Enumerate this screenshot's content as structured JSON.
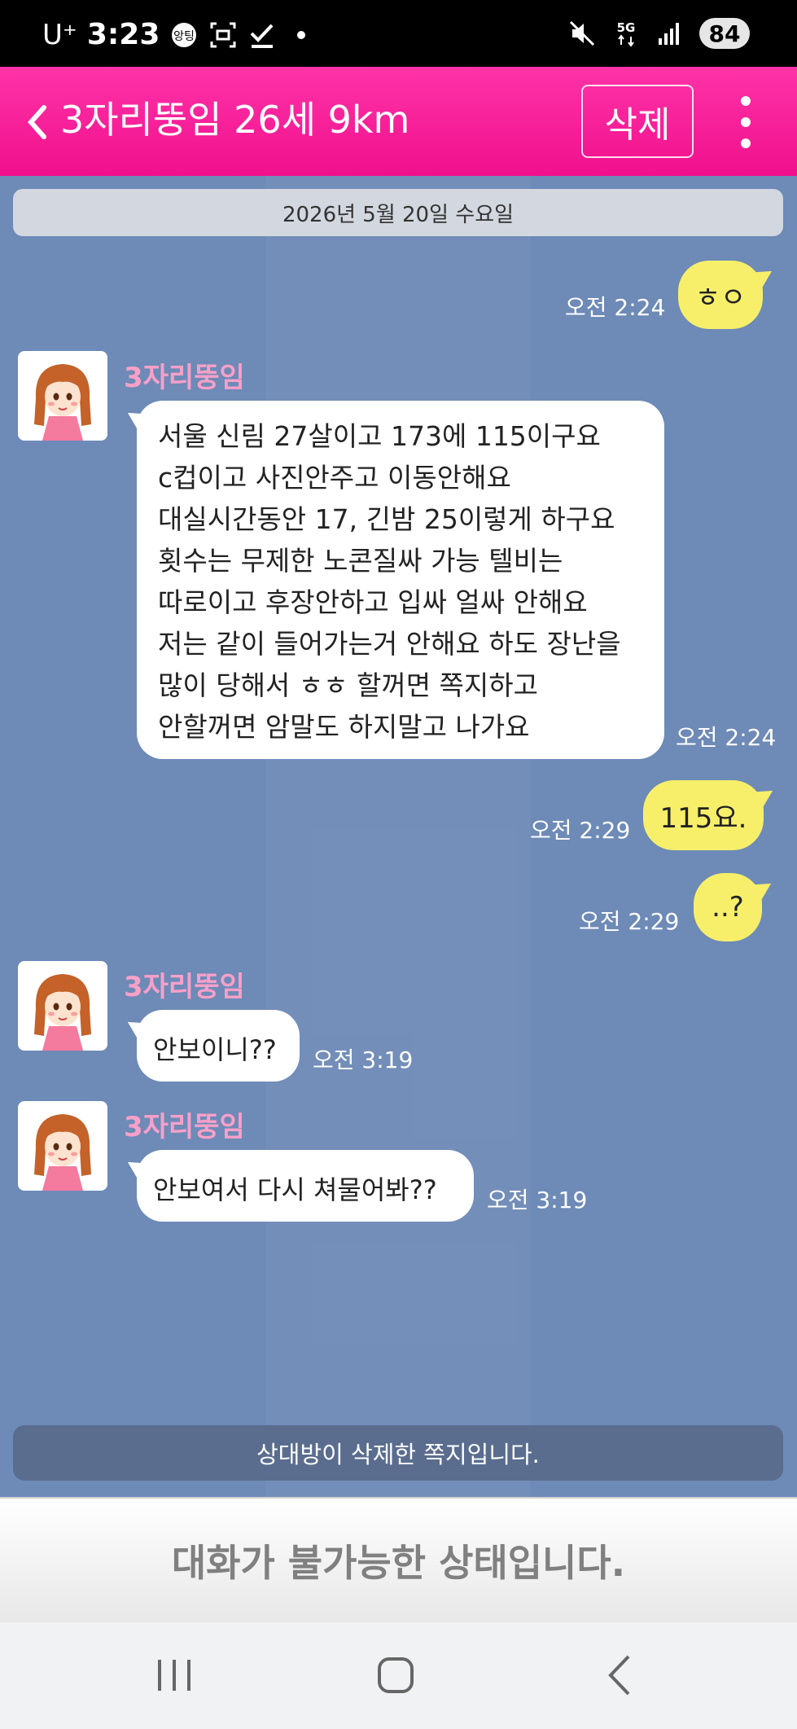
{
  "status_bar": {
    "carrier": "U⁺",
    "time": "3:23",
    "battery": "84",
    "icons": [
      "talk-icon",
      "screenshot-icon",
      "check-icon",
      "dot-icon",
      "mute-icon",
      "5g-icon",
      "signal-icon"
    ]
  },
  "header": {
    "title": "3자리뚱임 26세 9km",
    "delete_label": "삭제"
  },
  "chat": {
    "date_divider": "2026년 5월 20일 수요일",
    "messages": [
      {
        "direction": "out",
        "text": "ㅎㅇ",
        "time": "오전 2:24"
      },
      {
        "direction": "in",
        "sender": "3자리뚱임",
        "text": "서울 신림  27살이고  173에 115이구요\nc컵이고  사진안주고 이동안해요\n대실시간동안 17, 긴밤 25이렇게 하구요\n횟수는 무제한 노콘질싸 가능 텔비는\n따로이고 후장안하고 입싸 얼싸 안해요\n저는 같이 들어가는거 안해요 하도 장난을\n많이 당해서 ㅎㅎ 할꺼면 쪽지하고\n안할꺼면 암말도 하지말고 나가요",
        "time": "오전 2:24"
      },
      {
        "direction": "out",
        "text": "115요.",
        "time": "오전 2:29"
      },
      {
        "direction": "out",
        "text": "..?",
        "time": "오전 2:29"
      },
      {
        "direction": "in",
        "sender": "3자리뚱임",
        "text": "안보이니??",
        "time": "오전 3:19"
      },
      {
        "direction": "in",
        "sender": "3자리뚱임",
        "text": "안보여서 다시 쳐물어봐??",
        "time": "오전 3:19"
      }
    ],
    "deleted_notice": "상대방이 삭제한 쪽지입니다."
  },
  "footer": {
    "status_text": "대화가 불가능한 상태입니다."
  },
  "nav": {
    "buttons": [
      "recent-apps-icon",
      "home-icon",
      "back-icon"
    ]
  },
  "colors": {
    "header": "#f0108c",
    "chat_bg": "#6e8ab7",
    "outgoing_bubble": "#f7ef6a",
    "sender_name": "#f7a0c8"
  }
}
